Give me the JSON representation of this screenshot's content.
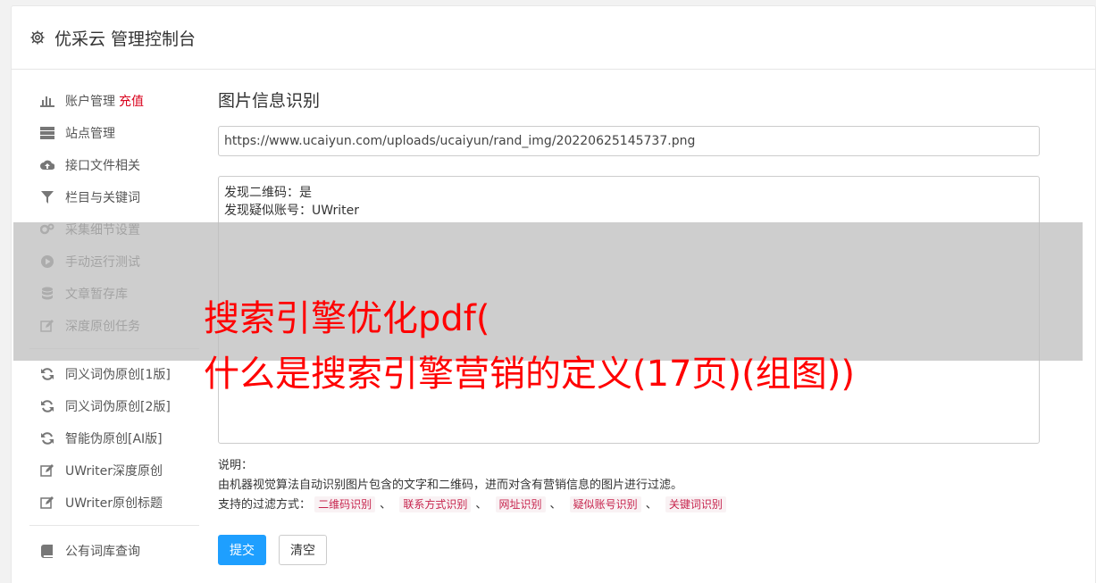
{
  "header": {
    "icon": "gear-icon",
    "title": "优采云 管理控制台"
  },
  "sidebar": {
    "group1": [
      {
        "label": "账户管理",
        "extra": "充值",
        "icon": "bar-chart-icon"
      },
      {
        "label": "站点管理",
        "icon": "server-icon"
      },
      {
        "label": "接口文件相关",
        "icon": "cloud-upload-icon"
      },
      {
        "label": "栏目与关键词",
        "icon": "filter-icon"
      },
      {
        "label": "采集细节设置",
        "icon": "gears-icon"
      },
      {
        "label": "手动运行测试",
        "icon": "play-circle-icon"
      },
      {
        "label": "文章暂存库",
        "icon": "database-icon"
      },
      {
        "label": "深度原创任务",
        "icon": "edit-icon"
      }
    ],
    "group2": [
      {
        "label": "同义词伪原创[1版]",
        "icon": "refresh-icon"
      },
      {
        "label": "同义词伪原创[2版]",
        "icon": "refresh-icon"
      },
      {
        "label": "智能伪原创[AI版]",
        "icon": "refresh-icon"
      },
      {
        "label": "UWriter深度原创",
        "icon": "edit-icon"
      },
      {
        "label": "UWriter原创标题",
        "icon": "edit-icon"
      }
    ],
    "group3": [
      {
        "label": "公有词库查询",
        "icon": "book-icon"
      }
    ]
  },
  "main": {
    "title": "图片信息识别",
    "url_value": "https://www.ucaiyun.com/uploads/ucaiyun/rand_img/20220625145737.png",
    "result_lines": [
      "发现二维码：是",
      "发现疑似账号：UWriter"
    ],
    "notes_label": "说明：",
    "notes_desc": "由机器视觉算法自动识别图片包含的文字和二维码，进而对含有营销信息的图片进行过滤。",
    "filters_label": "支持的过滤方式：",
    "filter_tags": [
      "二维码识别",
      "联系方式识别",
      "网址识别",
      "疑似账号识别",
      "关键词识别"
    ],
    "separator": "、",
    "submit_label": "提交",
    "clear_label": "清空"
  },
  "overlay": {
    "line1": "搜索引擎优化pdf(",
    "line2": "什么是搜索引擎营销的定义(17页)(组图))"
  },
  "colors": {
    "accent": "#1e9fff",
    "recharge": "#d9001b",
    "overlay_text": "#ff0000",
    "tag_text": "#c7254e"
  }
}
